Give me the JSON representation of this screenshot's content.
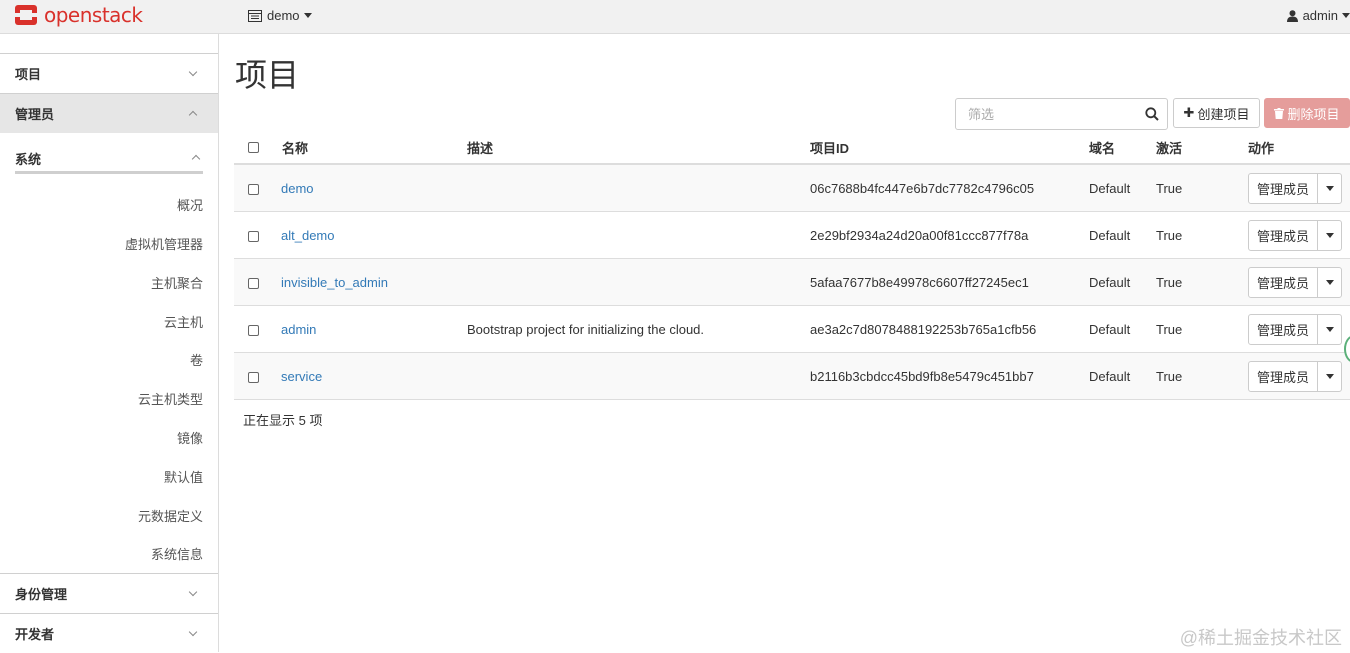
{
  "navbar": {
    "brand": "openstack",
    "project_selector": "demo",
    "user": "admin"
  },
  "sidebar": {
    "panels": [
      {
        "label": "项目"
      },
      {
        "label": "管理员"
      },
      {
        "label": "身份管理"
      },
      {
        "label": "开发者"
      }
    ],
    "system_group": "系统",
    "items": [
      "概况",
      "虚拟机管理器",
      "主机聚合",
      "云主机",
      "卷",
      "云主机类型",
      "镜像",
      "默认值",
      "元数据定义",
      "系统信息"
    ]
  },
  "main": {
    "title": "项目",
    "search_placeholder": "筛选",
    "create_label": "创建项目",
    "delete_label": "删除项目",
    "columns": [
      "名称",
      "描述",
      "项目ID",
      "域名",
      "激活",
      "动作"
    ],
    "rows": [
      {
        "name": "demo",
        "desc": "",
        "id": "06c7688b4fc447e6b7dc7782c4796c05",
        "domain": "Default",
        "enabled": "True",
        "action": "管理成员"
      },
      {
        "name": "alt_demo",
        "desc": "",
        "id": "2e29bf2934a24d20a00f81ccc877f78a",
        "domain": "Default",
        "enabled": "True",
        "action": "管理成员"
      },
      {
        "name": "invisible_to_admin",
        "desc": "",
        "id": "5afaa7677b8e49978c6607ff27245ec1",
        "domain": "Default",
        "enabled": "True",
        "action": "管理成员"
      },
      {
        "name": "admin",
        "desc": "Bootstrap project for initializing the cloud.",
        "id": "ae3a2c7d8078488192253b765a1cfb56",
        "domain": "Default",
        "enabled": "True",
        "action": "管理成员"
      },
      {
        "name": "service",
        "desc": "",
        "id": "b2116b3cbdcc45bd9fb8e5479c451bb7",
        "domain": "Default",
        "enabled": "True",
        "action": "管理成员"
      }
    ],
    "count_text": "正在显示 5 项"
  },
  "watermark": "@稀土掘金技术社区",
  "colors": {
    "brand": "#d9312b",
    "link": "#337ab7",
    "delete_button": "#e59d9b"
  },
  "icons": {
    "brand": "openstack-logo-icon",
    "project": "server-icon",
    "user": "user-icon",
    "search": "search-icon",
    "create": "plus-icon",
    "delete": "trash-icon"
  }
}
